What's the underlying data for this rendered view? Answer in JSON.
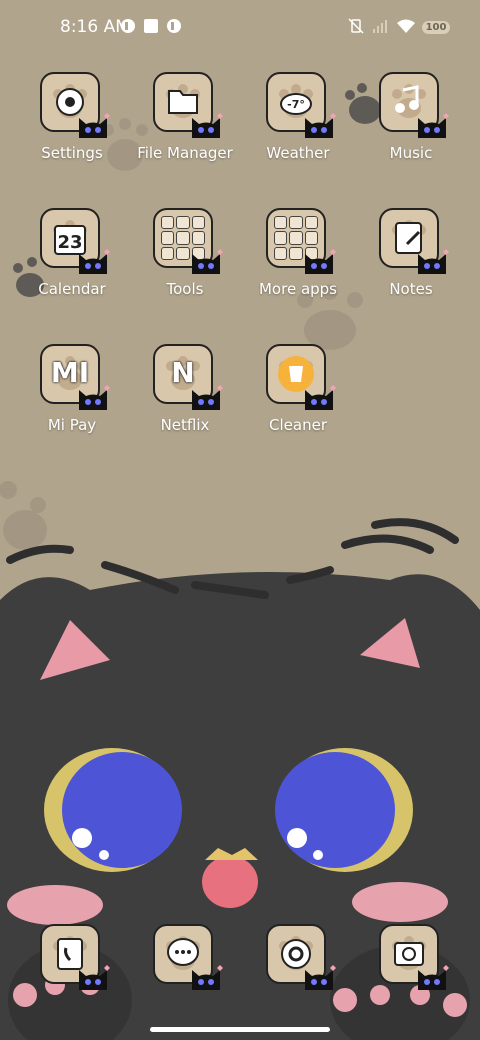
{
  "status_bar": {
    "time": "8:16 AM",
    "battery": "100",
    "icons": [
      "notification-icon",
      "square-icon",
      "notification-icon",
      "vibrate-off-icon",
      "signal-icon",
      "wifi-icon"
    ]
  },
  "apps": [
    {
      "label": "Settings",
      "icon": "settings-icon"
    },
    {
      "label": "File Manager",
      "icon": "folder-icon"
    },
    {
      "label": "Weather",
      "icon": "weather-icon",
      "badge": "-7°"
    },
    {
      "label": "Music",
      "icon": "music-icon"
    },
    {
      "label": "Calendar",
      "icon": "calendar-icon",
      "badge": "23"
    },
    {
      "label": "Tools",
      "icon": "folder-icon"
    },
    {
      "label": "More apps",
      "icon": "folder-icon"
    },
    {
      "label": "Notes",
      "icon": "notes-icon"
    },
    {
      "label": "Mi Pay",
      "icon": "mi-pay-icon",
      "badge": "MI"
    },
    {
      "label": "Netflix",
      "icon": "netflix-icon",
      "badge": "N"
    },
    {
      "label": "Cleaner",
      "icon": "cleaner-icon"
    }
  ],
  "dock": [
    {
      "icon": "contacts-phone-icon"
    },
    {
      "icon": "messages-icon"
    },
    {
      "icon": "chrome-icon"
    },
    {
      "icon": "camera-icon"
    }
  ],
  "colors": {
    "wallpaper": "#b0a48c",
    "tile": "#d8c7ab",
    "cat": "#3d3d3d",
    "eyes": "#4d55d6"
  }
}
